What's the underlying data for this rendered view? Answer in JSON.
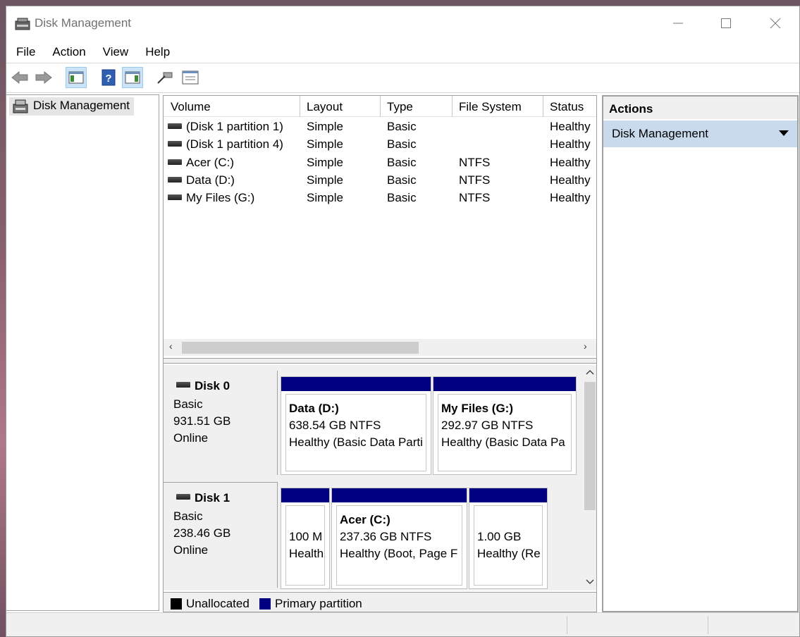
{
  "window": {
    "title": "Disk Management"
  },
  "menu": [
    "File",
    "Action",
    "View",
    "Help"
  ],
  "tree": {
    "root_label": "Disk Management"
  },
  "volumes": {
    "columns": [
      "Volume",
      "Layout",
      "Type",
      "File System",
      "Status"
    ],
    "rows": [
      {
        "volume": "(Disk 1 partition 1)",
        "layout": "Simple",
        "type": "Basic",
        "fs": "",
        "status": "Healthy"
      },
      {
        "volume": "(Disk 1 partition 4)",
        "layout": "Simple",
        "type": "Basic",
        "fs": "",
        "status": "Healthy"
      },
      {
        "volume": "Acer (C:)",
        "layout": "Simple",
        "type": "Basic",
        "fs": "NTFS",
        "status": "Healthy"
      },
      {
        "volume": "Data (D:)",
        "layout": "Simple",
        "type": "Basic",
        "fs": "NTFS",
        "status": "Healthy"
      },
      {
        "volume": "My Files (G:)",
        "layout": "Simple",
        "type": "Basic",
        "fs": "NTFS",
        "status": "Healthy"
      }
    ]
  },
  "disks": [
    {
      "name": "Disk 0",
      "kind": "Basic",
      "size": "931.51 GB",
      "state": "Online",
      "partitions": [
        {
          "title": "Data  (D:)",
          "size": "638.54 GB NTFS",
          "status": "Healthy (Basic Data Parti"
        },
        {
          "title": "My Files  (G:)",
          "size": "292.97 GB NTFS",
          "status": "Healthy (Basic Data Pa"
        }
      ]
    },
    {
      "name": "Disk 1",
      "kind": "Basic",
      "size": "238.46 GB",
      "state": "Online",
      "partitions": [
        {
          "title": "",
          "size": "100 M",
          "status": "Health"
        },
        {
          "title": "Acer  (C:)",
          "size": "237.36 GB NTFS",
          "status": "Healthy (Boot, Page F"
        },
        {
          "title": "",
          "size": "1.00 GB",
          "status": "Healthy (Re"
        }
      ]
    }
  ],
  "legend": [
    {
      "label": "Unallocated",
      "color": "#000000"
    },
    {
      "label": "Primary partition",
      "color": "#000080"
    }
  ],
  "actions": {
    "title": "Actions",
    "item": "Disk Management"
  },
  "icons": [
    "app-disk-icon",
    "back-arrow-icon",
    "forward-arrow-icon",
    "console-tree-icon",
    "help-icon",
    "action-pane-icon",
    "connect-icon",
    "properties-icon",
    "minimize-icon",
    "maximize-icon",
    "close-icon",
    "drive-icon",
    "dropdown-arrow-icon"
  ]
}
